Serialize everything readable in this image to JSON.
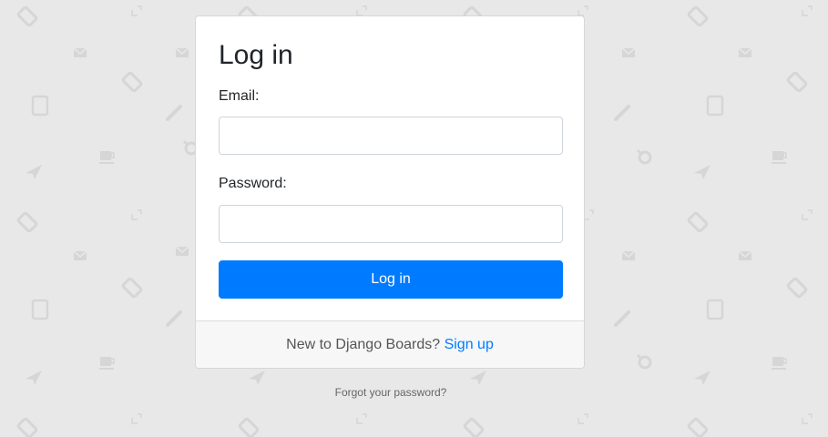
{
  "login": {
    "title": "Log in",
    "email_label": "Email:",
    "password_label": "Password:",
    "submit_label": "Log in"
  },
  "footer": {
    "prompt": "New to Django Boards?",
    "signup_label": "Sign up"
  },
  "forgot_password_label": "Forgot your password?",
  "colors": {
    "page_background": "#e8e8e8",
    "pattern_icons": "#d6d6d6",
    "primary_button": "#007bff",
    "link": "#007bff",
    "card_footer": "#f7f7f7"
  },
  "background_icons": [
    "tag-icon",
    "envelope-icon",
    "tablet-icon",
    "pencil-icon",
    "paper-plane-icon",
    "coffee-cup-icon",
    "corner-bracket-icon"
  ]
}
